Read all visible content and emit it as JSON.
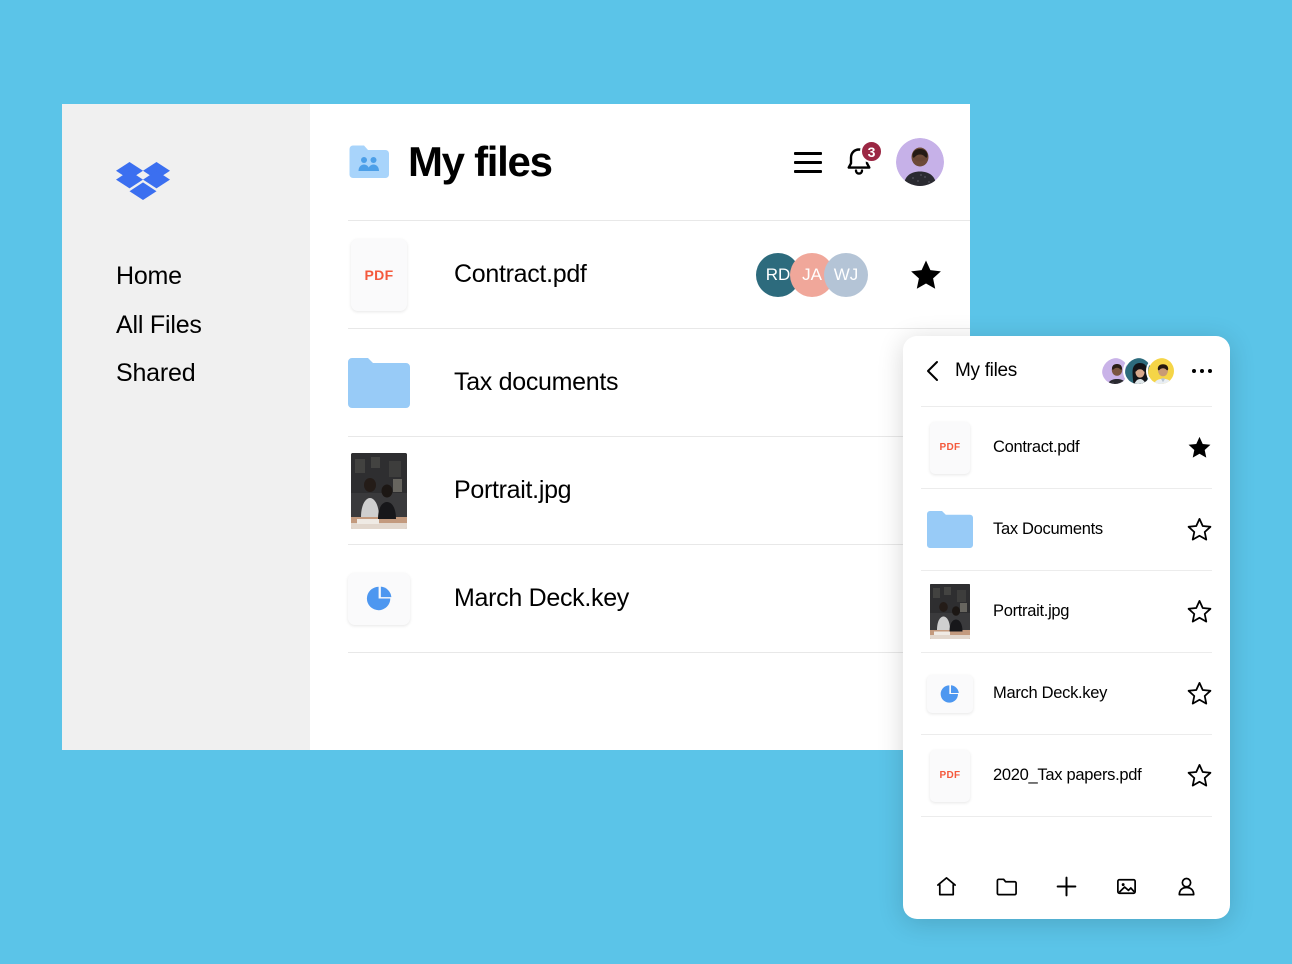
{
  "theme": {
    "background": "#5bc4e8",
    "sidebar_bg": "#f0f0f0",
    "panel_bg": "#ffffff",
    "accent_blue": "#4285f4",
    "folder_blue": "#98cbf7",
    "pdf_orange": "#f4593c",
    "badge_red": "#9b2743"
  },
  "sidebar": {
    "logo_name": "dropbox-logo",
    "items": [
      {
        "label": "Home",
        "name": "sidebar-item-home"
      },
      {
        "label": "All Files",
        "name": "sidebar-item-all-files"
      },
      {
        "label": "Shared",
        "name": "sidebar-item-shared"
      }
    ]
  },
  "header": {
    "folder_icon": "shared-folder-icon",
    "title": "My files",
    "menu_icon": "hamburger-menu-icon",
    "bell_icon": "notification-bell-icon",
    "notification_count": "3",
    "avatar_icon": "user-avatar"
  },
  "desktop_files": [
    {
      "name": "Contract.pdf",
      "kind": "pdf",
      "badge": "PDF",
      "starred": true,
      "collaborators": [
        {
          "initials": "RD",
          "color": "#2d6b7d"
        },
        {
          "initials": "JA",
          "color": "#f0a79a"
        },
        {
          "initials": "WJ",
          "color": "#b4c4d6"
        }
      ]
    },
    {
      "name": "Tax documents",
      "kind": "folder",
      "badge": "",
      "starred": false,
      "collaborators": []
    },
    {
      "name": "Portrait.jpg",
      "kind": "photo",
      "badge": "",
      "starred": false,
      "collaborators": []
    },
    {
      "name": "March Deck.key",
      "kind": "keynote",
      "badge": "",
      "starred": false,
      "collaborators": []
    }
  ],
  "mobile": {
    "back_icon": "back-chevron-icon",
    "title": "My files",
    "overflow_icon": "more-options-icon",
    "avatars": [
      {
        "name": "member-avatar-1",
        "bg": "#c9b3e8"
      },
      {
        "name": "member-avatar-2",
        "bg": "#2d6b7d"
      },
      {
        "name": "member-avatar-3",
        "bg": "#f5d547"
      }
    ],
    "files": [
      {
        "name": "Contract.pdf",
        "kind": "pdf",
        "badge": "PDF",
        "starred": true
      },
      {
        "name": "Tax Documents",
        "kind": "folder",
        "badge": "",
        "starred": false
      },
      {
        "name": "Portrait.jpg",
        "kind": "photo",
        "badge": "",
        "starred": false
      },
      {
        "name": "March Deck.key",
        "kind": "keynote",
        "badge": "",
        "starred": false
      },
      {
        "name": "2020_Tax papers.pdf",
        "kind": "pdf",
        "badge": "PDF",
        "starred": false
      }
    ],
    "toolbar": [
      {
        "name": "home-icon",
        "label": "Home"
      },
      {
        "name": "folder-icon",
        "label": "Files"
      },
      {
        "name": "plus-icon",
        "label": "Create"
      },
      {
        "name": "photos-icon",
        "label": "Photos"
      },
      {
        "name": "account-icon",
        "label": "Account"
      }
    ]
  }
}
